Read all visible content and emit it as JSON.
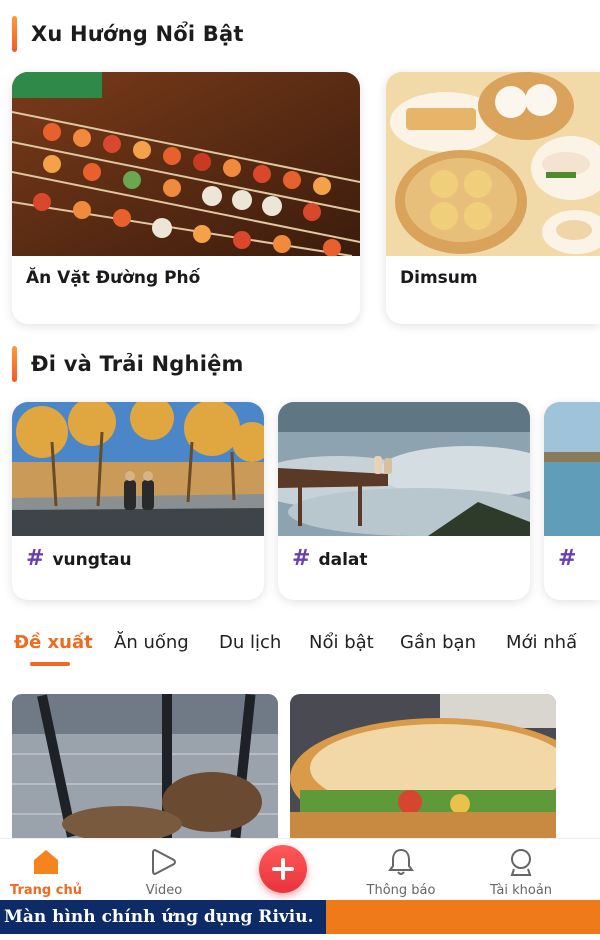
{
  "sections": {
    "trending": {
      "title": "Xu Hướng Nổi Bật",
      "cards": [
        {
          "label": "Ăn Vặt Đường Phố",
          "image": "street-food-skewers"
        },
        {
          "label": "Dimsum",
          "image": "dimsum-baskets"
        }
      ]
    },
    "travel": {
      "title": "Đi và Trải Nghiệm",
      "cards": [
        {
          "hashtag": "#",
          "label": "vungtau",
          "image": "autumn-road"
        },
        {
          "hashtag": "#",
          "label": "dalat",
          "image": "sea-of-clouds"
        },
        {
          "hashtag": "#",
          "label": "",
          "image": "coastline"
        }
      ]
    }
  },
  "tabs": [
    {
      "label": "Đề xuất",
      "active": true
    },
    {
      "label": "Ăn uống",
      "active": false
    },
    {
      "label": "Du lịch",
      "active": false
    },
    {
      "label": "Nổi bật",
      "active": false
    },
    {
      "label": "Gần bạn",
      "active": false
    },
    {
      "label": "Mới nhấ",
      "active": false
    }
  ],
  "feed": [
    {
      "image": "iced-coffee-cups"
    },
    {
      "image": "banh-mi-sandwich"
    }
  ],
  "bottom_nav": {
    "home": {
      "label": "Trang chủ",
      "icon": "home-icon"
    },
    "video": {
      "label": "Video",
      "icon": "play-icon"
    },
    "add": {
      "icon": "plus-icon"
    },
    "notifications": {
      "label": "Thông báo",
      "icon": "bell-icon"
    },
    "account": {
      "label": "Tài khoản",
      "icon": "user-icon"
    }
  },
  "caption": "Màn hình chính ứng dụng Riviu.",
  "colors": {
    "accent": "#ee6a1f",
    "hashtag": "#6a3fb0",
    "add_button": "#e9323c",
    "caption_bar": "#ef7a1a",
    "caption_box": "#0d2b66"
  }
}
